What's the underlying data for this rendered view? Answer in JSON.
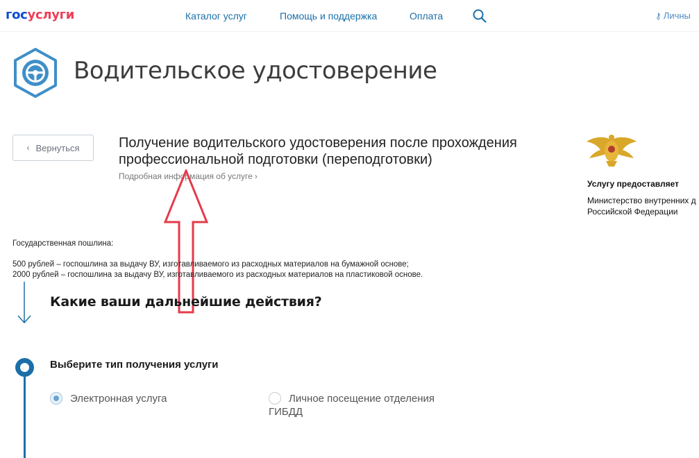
{
  "header": {
    "logo_part1": "гос",
    "logo_part2": "услуги",
    "nav": [
      "Каталог услуг",
      "Помощь и поддержка",
      "Оплата"
    ],
    "login_label": "Личны"
  },
  "page": {
    "title": "Водительское удостоверение"
  },
  "back_button": {
    "label": "Вернуться"
  },
  "service": {
    "title": "Получение водительского удостоверения после прохождения профессиональной подготовки (переподготовки)",
    "details_link": "Подробная информация об услуге"
  },
  "provider": {
    "label": "Услугу предоставляет",
    "name_line1": "Министерство внутренних д",
    "name_line2": "Российской Федерации"
  },
  "fee": {
    "title": "Государственная пошлина:",
    "lines": [
      "500 рублей – госпошлина за выдачу ВУ, изготавливаемого из расходных материалов на бумажной основе;",
      "2000 рублей – госпошлина за выдачу ВУ, изготавливаемого из расходных материалов на пластиковой основе."
    ]
  },
  "next_steps": {
    "title": "Какие ваши дальнейшие действия?"
  },
  "step": {
    "title": "Выберите тип получения услуги",
    "options": [
      {
        "label": "Электронная услуга",
        "selected": true
      },
      {
        "label": "Личное посещение отделения ГИБДД",
        "selected": false
      }
    ]
  },
  "colors": {
    "accent": "#1b6fa8",
    "annotation": "#e53a4a"
  }
}
